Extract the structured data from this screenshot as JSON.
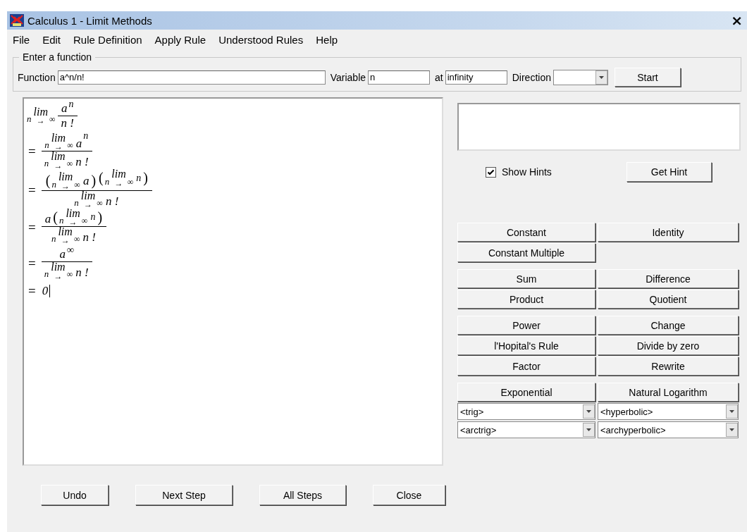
{
  "window": {
    "title": "Calculus 1 - Limit Methods",
    "close": "×"
  },
  "menu": [
    {
      "label": "File"
    },
    {
      "label": "Edit"
    },
    {
      "label": "Rule Definition"
    },
    {
      "label": "Apply Rule"
    },
    {
      "label": "Understood Rules"
    },
    {
      "label": "Help"
    }
  ],
  "function_group": {
    "title": "Enter a function",
    "function_label": "Function",
    "function_value": "a^n/n!",
    "variable_label": "Variable",
    "variable_value": "n",
    "at_label": "at",
    "at_value": "infinity",
    "direction_label": "Direction",
    "start": "Start"
  },
  "steps": [
    {
      "items": [
        {
          "kind": "lim",
          "var": "n",
          "word": "lim",
          "arrow": "→",
          "to": "∞"
        },
        {
          "kind": "frac",
          "num": [
            {
              "kind": "text",
              "s": "a"
            },
            {
              "kind": "sup",
              "items": [
                {
                  "kind": "text",
                  "s": "n"
                }
              ]
            }
          ],
          "den": [
            {
              "kind": "text",
              "s": "n !"
            }
          ]
        }
      ]
    },
    {
      "eq": "=",
      "items": [
        {
          "kind": "frac",
          "num": [
            {
              "kind": "lim",
              "var": "n",
              "word": "lim",
              "arrow": "→",
              "to": "∞"
            },
            {
              "kind": "text",
              "s": "a"
            },
            {
              "kind": "sup",
              "items": [
                {
                  "kind": "text",
                  "s": "n"
                }
              ]
            }
          ],
          "den": [
            {
              "kind": "lim",
              "var": "n",
              "word": "lim",
              "arrow": "→",
              "to": "∞"
            },
            {
              "kind": "text",
              "s": "n !"
            }
          ]
        }
      ]
    },
    {
      "eq": "=",
      "items": [
        {
          "kind": "frac",
          "num": [
            {
              "kind": "paren",
              "open": "(",
              "close": ")",
              "items": [
                {
                  "kind": "lim",
                  "var": "n",
                  "word": "lim",
                  "arrow": "→",
                  "to": "∞"
                },
                {
                  "kind": "text",
                  "s": "a"
                }
              ]
            },
            {
              "kind": "sup",
              "items": [
                {
                  "kind": "paren",
                  "open": "(",
                  "close": ")",
                  "items": [
                    {
                      "kind": "lim",
                      "var": "n",
                      "word": "lim",
                      "arrow": "→",
                      "to": "∞"
                    },
                    {
                      "kind": "text",
                      "s": "n"
                    }
                  ]
                }
              ]
            }
          ],
          "den": [
            {
              "kind": "lim",
              "var": "n",
              "word": "lim",
              "arrow": "→",
              "to": "∞"
            },
            {
              "kind": "text",
              "s": "n !"
            }
          ]
        }
      ]
    },
    {
      "eq": "=",
      "items": [
        {
          "kind": "frac",
          "num": [
            {
              "kind": "text",
              "s": "a"
            },
            {
              "kind": "sup",
              "items": [
                {
                  "kind": "paren",
                  "open": "(",
                  "close": ")",
                  "items": [
                    {
                      "kind": "lim",
                      "var": "n",
                      "word": "lim",
                      "arrow": "→",
                      "to": "∞"
                    },
                    {
                      "kind": "text",
                      "s": "n"
                    }
                  ]
                }
              ]
            }
          ],
          "den": [
            {
              "kind": "lim",
              "var": "n",
              "word": "lim",
              "arrow": "→",
              "to": "∞"
            },
            {
              "kind": "text",
              "s": "n !"
            }
          ]
        }
      ]
    },
    {
      "eq": "=",
      "items": [
        {
          "kind": "frac",
          "num": [
            {
              "kind": "text",
              "s": "a"
            },
            {
              "kind": "sup",
              "items": [
                {
                  "kind": "text",
                  "s": "∞"
                }
              ]
            }
          ],
          "den": [
            {
              "kind": "lim",
              "var": "n",
              "word": "lim",
              "arrow": "→",
              "to": "∞"
            },
            {
              "kind": "text",
              "s": "n !"
            }
          ]
        }
      ]
    },
    {
      "eq": "=",
      "items": [
        {
          "kind": "text",
          "s": "0"
        }
      ],
      "cursor": true
    }
  ],
  "hints": {
    "show_hints": {
      "label": "Show Hints",
      "checked": true
    },
    "get_hint": "Get Hint"
  },
  "rule_groups": [
    [
      {
        "kind": "button",
        "label": "Constant"
      },
      {
        "kind": "button",
        "label": "Identity"
      },
      {
        "kind": "button",
        "label": "Constant Multiple"
      }
    ],
    [
      {
        "kind": "button",
        "label": "Sum"
      },
      {
        "kind": "button",
        "label": "Difference"
      },
      {
        "kind": "button",
        "label": "Product"
      },
      {
        "kind": "button",
        "label": "Quotient"
      }
    ],
    [
      {
        "kind": "button",
        "label": "Power"
      },
      {
        "kind": "button",
        "label": "Change"
      },
      {
        "kind": "button",
        "label": "l'Hopital's Rule"
      },
      {
        "kind": "button",
        "label": "Divide by zero"
      },
      {
        "kind": "button",
        "label": "Factor"
      },
      {
        "kind": "button",
        "label": "Rewrite"
      }
    ],
    [
      {
        "kind": "button",
        "label": "Exponential"
      },
      {
        "kind": "button",
        "label": "Natural Logarithm"
      },
      {
        "kind": "select",
        "label": "<trig>"
      },
      {
        "kind": "select",
        "label": "<hyperbolic>"
      },
      {
        "kind": "select",
        "label": "<arctrig>"
      },
      {
        "kind": "select",
        "label": "<archyperbolic>"
      }
    ]
  ],
  "bottom_buttons": [
    {
      "label": "Undo"
    },
    {
      "label": "Next Step"
    },
    {
      "label": "All Steps"
    },
    {
      "label": "Close"
    }
  ]
}
